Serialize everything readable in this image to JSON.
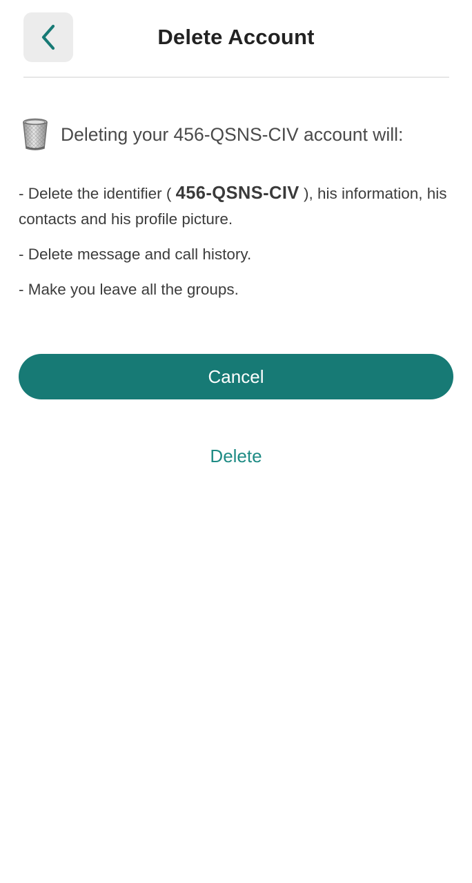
{
  "header": {
    "back_icon": "chevron-left-icon",
    "title": "Delete Account"
  },
  "intro": {
    "icon": "trash-can-icon",
    "text": "Deleting your 456-QSNS-CIV account will:"
  },
  "consequences": {
    "item1_prefix": "- Delete the identifier ( ",
    "item1_identifier": "456-QSNS-CIV",
    "item1_suffix": " ), his information, his contacts and his profile picture.",
    "item2": "- Delete message and call history.",
    "item3": "- Make you leave all the groups."
  },
  "actions": {
    "cancel_label": "Cancel",
    "delete_label": "Delete"
  },
  "colors": {
    "accent": "#177a75",
    "link": "#1e8b84",
    "back_button_bg": "#ececec"
  }
}
